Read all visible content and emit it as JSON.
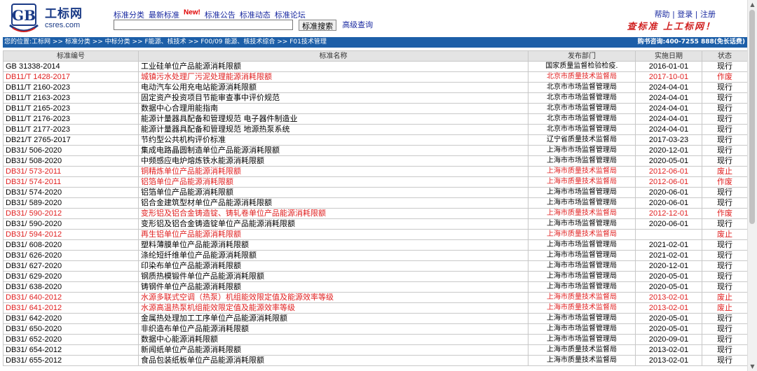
{
  "header": {
    "logo_letters": "GB",
    "brand_cn": "工标网",
    "brand_en": "csres.com",
    "nav": [
      "标准分类",
      "最新标准",
      "标准公告",
      "标准动态",
      "标准论坛"
    ],
    "new_badge": "New!",
    "search_placeholder": "",
    "search_button": "标准搜索",
    "advanced_search": "高级查询",
    "help": "帮助",
    "login": "登录",
    "register": "注册",
    "separator": "|",
    "slogan": "查标准 上工标网！"
  },
  "breadcrumb": {
    "text": "您的位置:工标网 >> 标准分类 >> 中标分类 >> F能源、核技术 >> F00/09 能源、核技术综合 >> F01技术管理",
    "hotline": "购书咨询:400-7255 888(免长话费)"
  },
  "colors": {
    "brand_blue": "#1a3a86",
    "bar_blue": "#1d5fa8",
    "abolished_red": "#e02020"
  },
  "table": {
    "headers": [
      "标准编号",
      "标准名称",
      "发布部门",
      "实施日期",
      "状态"
    ],
    "rows": [
      {
        "code": "GB 31338-2014",
        "name": "工业硅单位产品能源消耗限额",
        "dept": "国家质量监督检验检疫.",
        "date": "2016-01-01",
        "status": "现行"
      },
      {
        "code": "DB11/T 1428-2017",
        "name": "城镇污水处理厂污泥处理能源消耗限额",
        "dept": "北京市质量技术监督局",
        "date": "2017-10-01",
        "status": "作废"
      },
      {
        "code": "DB11/T 2160-2023",
        "name": "电动汽车公用充电站能源消耗限额",
        "dept": "北京市市场监督管理局",
        "date": "2024-04-01",
        "status": "现行"
      },
      {
        "code": "DB11/T 2163-2023",
        "name": "固定资产投资项目节能审查事中评价规范",
        "dept": "北京市市场监督管理局",
        "date": "2024-04-01",
        "status": "现行"
      },
      {
        "code": "DB11/T 2165-2023",
        "name": "数据中心合理用能指南",
        "dept": "北京市市场监督管理局",
        "date": "2024-04-01",
        "status": "现行"
      },
      {
        "code": "DB11/T 2176-2023",
        "name": "能源计量器具配备和管理规范 电子器件制造业",
        "dept": "北京市市场监督管理局",
        "date": "2024-04-01",
        "status": "现行"
      },
      {
        "code": "DB11/T 2177-2023",
        "name": "能源计量器具配备和管理规范 地源热泵系统",
        "dept": "北京市市场监督管理局",
        "date": "2024-04-01",
        "status": "现行"
      },
      {
        "code": "DB21/T 2765-2017",
        "name": "节约型公共机构评价标准",
        "dept": "辽宁省质量技术监督局",
        "date": "2017-03-23",
        "status": "现行"
      },
      {
        "code": "DB31/ 506-2020",
        "name": "集成电路晶圆制造单位产品能源消耗限额",
        "dept": "上海市市场监督管理局",
        "date": "2020-12-01",
        "status": "现行"
      },
      {
        "code": "DB31/ 508-2020",
        "name": "中频感应电炉熔炼铁水能源消耗限额",
        "dept": "上海市市场监督管理局",
        "date": "2020-05-01",
        "status": "现行"
      },
      {
        "code": "DB31/ 573-2011",
        "name": "铜精炼单位产品能源消耗限额",
        "dept": "上海市质量技术监督局",
        "date": "2012-06-01",
        "status": "废止"
      },
      {
        "code": "DB31/ 574-2011",
        "name": "铝箔单位产品能源消耗限额",
        "dept": "上海市质量技术监督局",
        "date": "2012-06-01",
        "status": "作废"
      },
      {
        "code": "DB31/ 574-2020",
        "name": "铝箔单位产品能源消耗限额",
        "dept": "上海市市场监督管理局",
        "date": "2020-06-01",
        "status": "现行"
      },
      {
        "code": "DB31/ 589-2020",
        "name": "铝合金建筑型材单位产品能源消耗限额",
        "dept": "上海市市场监督管理局",
        "date": "2020-06-01",
        "status": "现行"
      },
      {
        "code": "DB31/ 590-2012",
        "name": "变形铝及铝合金铸造锭、铸轧卷单位产品能源消耗限额",
        "dept": "上海市质量技术监督局",
        "date": "2012-12-01",
        "status": "作废"
      },
      {
        "code": "DB31/ 590-2020",
        "name": "变形铝及铝合金铸造锭单位产品能源消耗限额",
        "dept": "上海市市场监督管理局",
        "date": "2020-06-01",
        "status": "现行"
      },
      {
        "code": "DB31/ 594-2012",
        "name": "再生铝单位产品能源消耗限额",
        "dept": "上海市质量技术监督局",
        "date": "",
        "status": "废止"
      },
      {
        "code": "DB31/ 608-2020",
        "name": "塑料薄膜单位产品能源消耗限额",
        "dept": "上海市市场监督管理局",
        "date": "2021-02-01",
        "status": "现行"
      },
      {
        "code": "DB31/ 626-2020",
        "name": "涤纶短纤维单位产品能源消耗限额",
        "dept": "上海市市场监督管理局",
        "date": "2021-02-01",
        "status": "现行"
      },
      {
        "code": "DB31/ 627-2020",
        "name": "印染布单位产品能源消耗限额",
        "dept": "上海市市场监督管理局",
        "date": "2020-12-01",
        "status": "现行"
      },
      {
        "code": "DB31/ 629-2020",
        "name": "钢质热模锻件单位产品能源消耗限额",
        "dept": "上海市市场监督管理局",
        "date": "2020-05-01",
        "status": "现行"
      },
      {
        "code": "DB31/ 638-2020",
        "name": "铸钢件单位产品能源消耗限额",
        "dept": "上海市市场监督管理局",
        "date": "2020-05-01",
        "status": "现行"
      },
      {
        "code": "DB31/ 640-2012",
        "name": "水源多联式空调（热泵）机组能效限定值及能源效率等级",
        "dept": "上海市质量技术监督局",
        "date": "2013-02-01",
        "status": "废止"
      },
      {
        "code": "DB31/ 641-2012",
        "name": "水源高温热泵机组能效限定值及能源效率等级",
        "dept": "上海市质量技术监督局",
        "date": "2013-02-01",
        "status": "废止"
      },
      {
        "code": "DB31/ 642-2020",
        "name": "金属热处理加工工序单位产品能源消耗限额",
        "dept": "上海市市场监督管理局",
        "date": "2020-05-01",
        "status": "现行"
      },
      {
        "code": "DB31/ 650-2020",
        "name": "非织造布单位产品能源消耗限额",
        "dept": "上海市市场监督管理局",
        "date": "2020-05-01",
        "status": "现行"
      },
      {
        "code": "DB31/ 652-2020",
        "name": "数据中心能源消耗限额",
        "dept": "上海市市场监督管理局",
        "date": "2020-09-01",
        "status": "现行"
      },
      {
        "code": "DB31/ 654-2012",
        "name": "新闻纸单位产品能源消耗限额",
        "dept": "上海市质量技术监督局",
        "date": "2013-02-01",
        "status": "现行"
      },
      {
        "code": "DB31/ 655-2012",
        "name": "食品包装纸板单位产品能源消耗限额",
        "dept": "上海市质量技术监督局",
        "date": "2013-02-01",
        "status": "现行"
      }
    ]
  }
}
